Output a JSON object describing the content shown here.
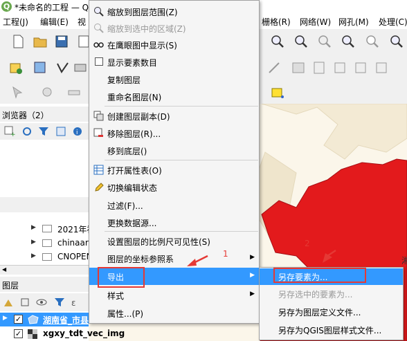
{
  "window": {
    "title": "*未命名的工程 — Q",
    "logo_letter": "Q"
  },
  "menubar": {
    "items_left": [
      "工程(J)",
      "编辑(E)",
      "视"
    ],
    "items_right": [
      "栅格(R)",
      "网络(W)",
      "网孔(M)",
      "处理(C)"
    ]
  },
  "browser_panel": {
    "title": "浏览器（2）",
    "tree": [
      "2021年福",
      "chinaare",
      "CNOPEN"
    ]
  },
  "layers_panel": {
    "title": "图层",
    "layers": [
      {
        "name": "湖南省_市县",
        "checked": true,
        "selected": true
      },
      {
        "name": "xgxy_tdt_vec_img",
        "checked": true,
        "selected": false
      }
    ]
  },
  "context_menu": {
    "items": [
      {
        "label": "缩放到图层范围(Z)",
        "icon": "zoom-layer-icon",
        "disabled": false
      },
      {
        "label": "缩放到选中的区域(Z)",
        "icon": "zoom-selection-icon",
        "disabled": true
      },
      {
        "label": "在鹰眼图中显示(S)",
        "icon": "overview-icon",
        "disabled": false
      },
      {
        "label": "显示要素数目",
        "icon": "checkbox-icon",
        "disabled": false
      },
      {
        "label": "复制图层",
        "icon": "",
        "disabled": false
      },
      {
        "label": "重命名图层(N)",
        "icon": "",
        "disabled": false
      },
      {
        "label": "创建图层副本(D)",
        "icon": "duplicate-layer-icon",
        "disabled": false
      },
      {
        "label": "移除图层(R)...",
        "icon": "remove-layer-icon",
        "disabled": false
      },
      {
        "label": "移到底层()",
        "icon": "",
        "disabled": false
      },
      {
        "label": "打开属性表(O)",
        "icon": "attribute-table-icon",
        "disabled": false
      },
      {
        "label": "切换编辑状态",
        "icon": "pencil-icon",
        "disabled": false
      },
      {
        "label": "过滤(F)...",
        "icon": "",
        "disabled": false
      },
      {
        "label": "更换数据源...",
        "icon": "",
        "disabled": false
      },
      {
        "label": "设置图层的比例尺可见性(S)",
        "icon": "",
        "disabled": false
      },
      {
        "label": "图层的坐标参照系",
        "icon": "",
        "disabled": false,
        "submenu": true
      },
      {
        "label": "导出",
        "icon": "",
        "disabled": false,
        "submenu": true,
        "highlighted": true
      },
      {
        "label": "样式",
        "icon": "",
        "disabled": false,
        "submenu": true
      },
      {
        "label": "属性...(P)",
        "icon": "",
        "disabled": false
      }
    ]
  },
  "export_submenu": {
    "items": [
      {
        "label": "另存要素为...",
        "highlighted": true,
        "disabled": false
      },
      {
        "label": "另存选中的要素为...",
        "highlighted": false,
        "disabled": true
      },
      {
        "label": "另存为图层定义文件...",
        "highlighted": false,
        "disabled": false
      },
      {
        "label": "另存为QGIS图层样式文件...",
        "highlighted": false,
        "disabled": false
      }
    ]
  },
  "map": {
    "label_fragment": "湘",
    "polygon_color": "#e31a1c",
    "background_color": "#fbf6ea"
  },
  "annotations": {
    "step1": "1",
    "step2": "2",
    "color": "#e53935"
  },
  "colors": {
    "highlight": "#3399ff",
    "menu_bg": "#f5f5f5"
  }
}
